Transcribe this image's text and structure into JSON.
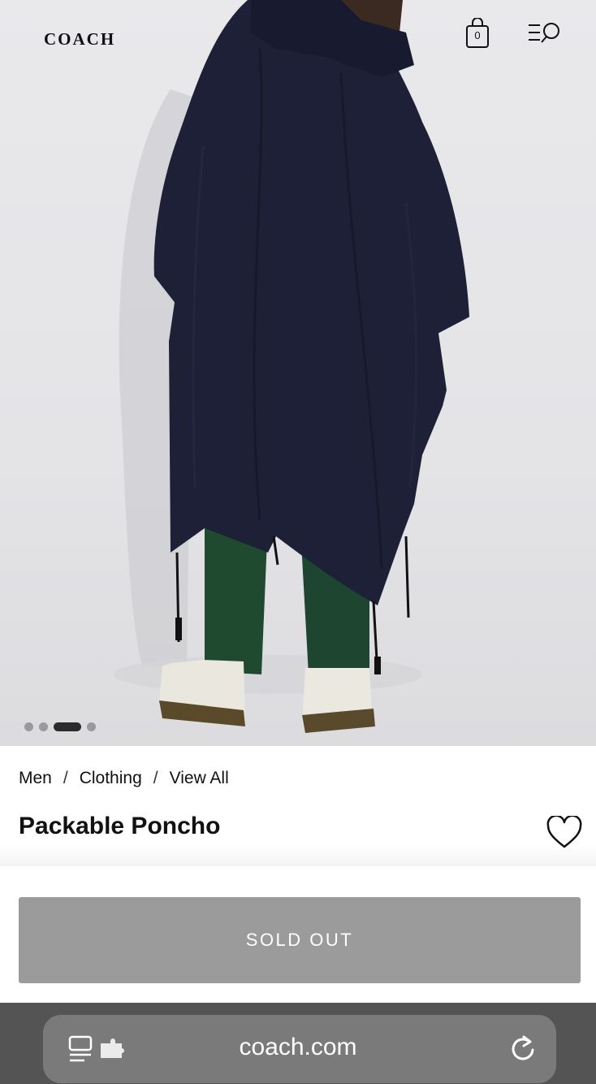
{
  "header": {
    "logo": "COACH",
    "bag_count": "0",
    "icons": [
      "shopping-bag-icon",
      "menu-search-icon"
    ]
  },
  "gallery": {
    "slide_count": 4,
    "active_index": 2
  },
  "breadcrumb": {
    "items": [
      "Men",
      "Clothing",
      "View All"
    ],
    "separator": "/"
  },
  "product": {
    "title": "Packable Poncho"
  },
  "cta": {
    "label": "SOLD OUT"
  },
  "browser": {
    "url": "coach.com"
  },
  "colors": {
    "poncho": "#1d2036",
    "pants": "#1f4a30",
    "button_disabled": "#9b9b9b",
    "browser_bar": "#545454"
  }
}
